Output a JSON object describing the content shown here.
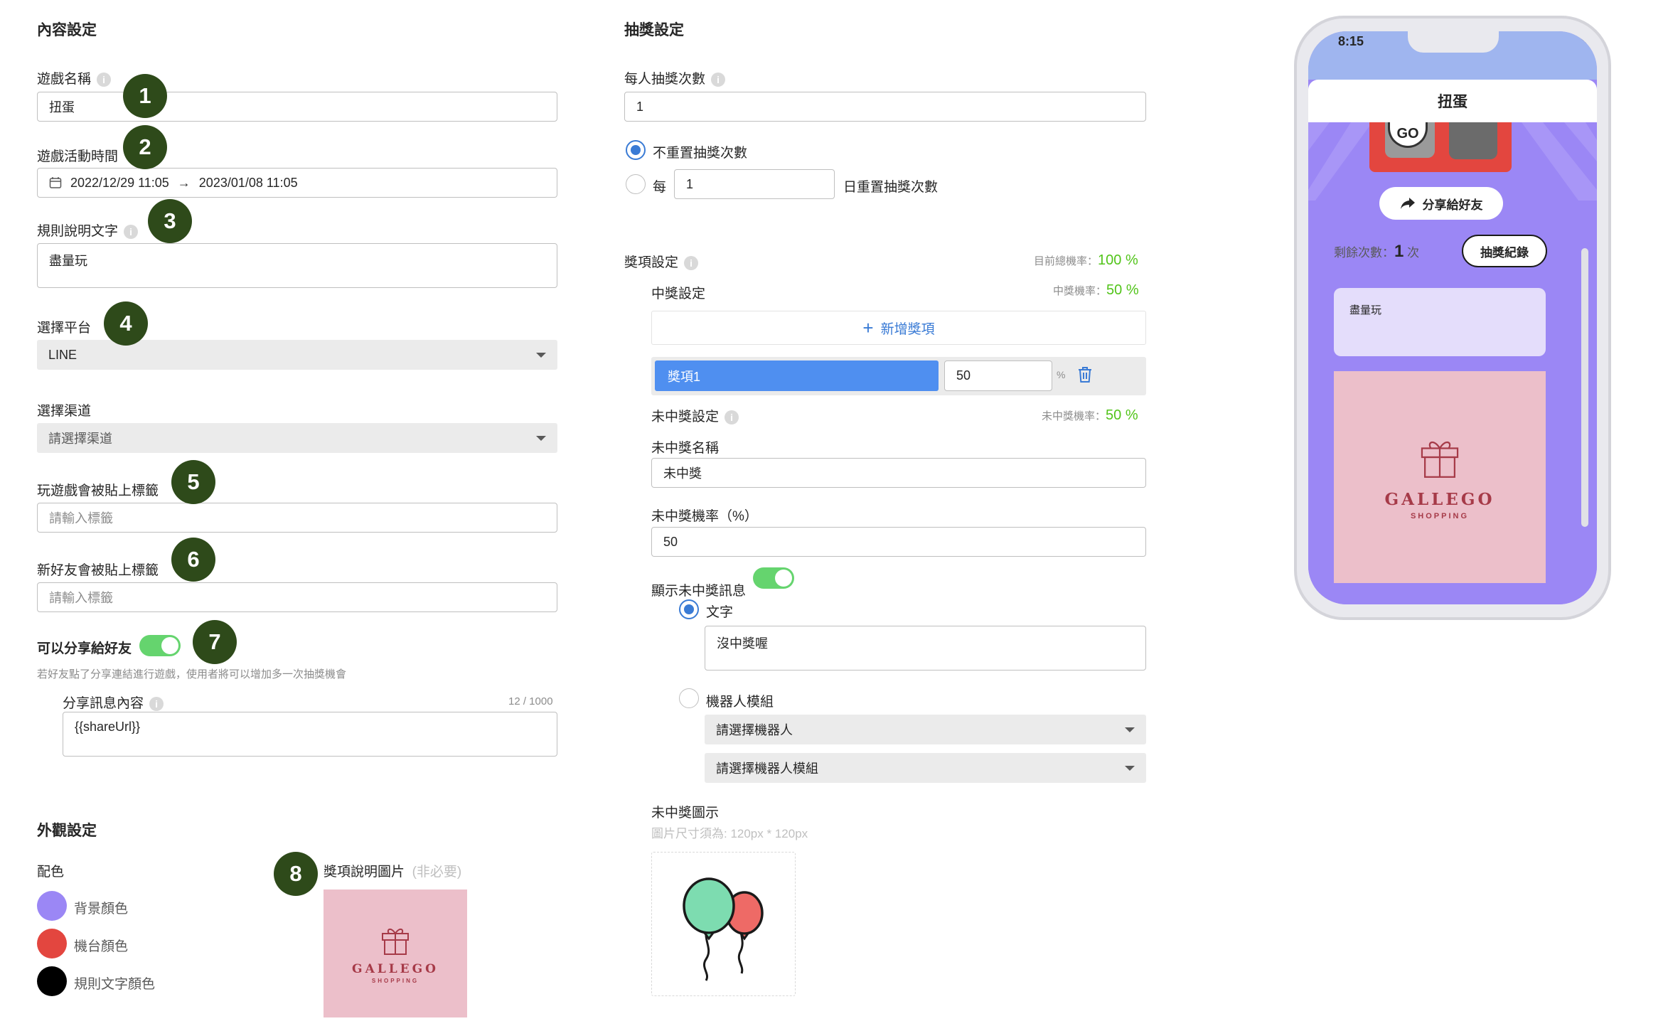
{
  "content_settings": {
    "title": "內容設定",
    "game_name_label": "遊戲名稱",
    "game_name_value": "扭蛋",
    "game_time_label": "遊戲活動時間",
    "game_time_start": "2022/12/29 11:05",
    "game_time_end": "2023/01/08 11:05",
    "rules_label": "規則說明文字",
    "rules_value": "盡量玩",
    "platform_label": "選擇平台",
    "platform_value": "LINE",
    "channel_label": "選擇渠道",
    "channel_placeholder": "請選擇渠道",
    "play_tag_label": "玩遊戲會被貼上標籤",
    "play_tag_placeholder": "請輸入標籤",
    "friend_tag_label": "新好友會被貼上標籤",
    "friend_tag_placeholder": "請輸入標籤",
    "share_label": "可以分享給好友",
    "share_hint": "若好友點了分享連結進行遊戲，使用者將可以增加多一次抽獎機會",
    "share_msg_label": "分享訊息內容",
    "share_msg_count": "12 / 1000",
    "share_msg_value": "{{shareUrl}}"
  },
  "appearance": {
    "title": "外觀設定",
    "colors_label": "配色",
    "colors": [
      {
        "label": "背景顏色",
        "color": "#9b87f5"
      },
      {
        "label": "機台顏色",
        "color": "#e3463f"
      },
      {
        "label": "規則文字顏色",
        "color": "#000000"
      }
    ],
    "prize_image_label": "獎項說明圖片",
    "prize_image_optional": "(非必要)"
  },
  "badges": [
    "1",
    "2",
    "3",
    "4",
    "5",
    "6",
    "7",
    "8"
  ],
  "lottery": {
    "title": "抽獎設定",
    "per_person_label": "每人抽獎次數",
    "per_person_value": "1",
    "no_reset_label": "不重置抽獎次數",
    "every_label": "每",
    "every_value": "1",
    "daily_reset_label": "日重置抽獎次數"
  },
  "prizes": {
    "title": "獎項設定",
    "total_rate_label": "目前總機率：",
    "total_rate_value": "100 %",
    "win_label": "中獎設定",
    "win_rate_label": "中獎機率：",
    "win_rate_value": "50 %",
    "add_label": "新增獎項",
    "item_name": "獎項1",
    "item_rate": "50",
    "item_unit": "%",
    "lose_label": "未中獎設定",
    "lose_rate_label": "未中獎機率：",
    "lose_rate_value": "50 %",
    "lose_name_label": "未中獎名稱",
    "lose_name_value": "未中獎",
    "lose_prob_label": "未中獎機率（%）",
    "lose_prob_value": "50",
    "show_msg_label": "顯示未中獎訊息",
    "text_option": "文字",
    "text_value": "沒中獎喔",
    "bot_option": "機器人模組",
    "bot_placeholder": "請選擇機器人",
    "bot_module_placeholder": "請選擇機器人模組",
    "lose_icon_label": "未中獎圖示",
    "lose_icon_hint": "圖片尺寸須為: 120px * 120px"
  },
  "phone": {
    "time": "8:15",
    "title": "扭蛋",
    "go_label": "GO",
    "share_button": "分享給好友",
    "remaining_label": "剩餘次數：",
    "remaining_value": "1",
    "remaining_unit": "次",
    "record_button": "抽獎紀錄",
    "rules_text": "盡量玩"
  },
  "logo": {
    "name": "GALLEGO",
    "sub": "SHOPPING"
  }
}
